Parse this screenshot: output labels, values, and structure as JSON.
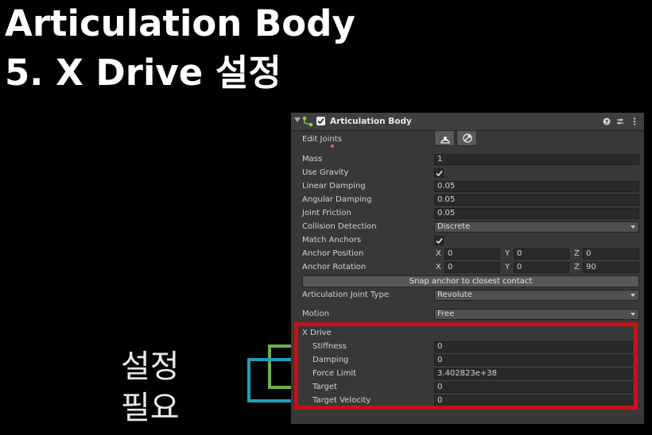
{
  "title": {
    "line1": "Articulation Body",
    "line2": "5. X Drive 설정"
  },
  "note": {
    "line1": "설정",
    "line2": "필요"
  },
  "panel": {
    "header": {
      "title": "Articulation Body",
      "enabled": true
    },
    "edit_joints_label": "Edit Joints",
    "mass": {
      "label": "Mass",
      "value": "1"
    },
    "use_gravity": {
      "label": "Use Gravity",
      "checked": true
    },
    "linear_damping": {
      "label": "Linear Damping",
      "value": "0.05"
    },
    "angular_damping": {
      "label": "Angular Damping",
      "value": "0.05"
    },
    "joint_friction": {
      "label": "Joint Friction",
      "value": "0.05"
    },
    "collision_detection": {
      "label": "Collision Detection",
      "value": "Discrete"
    },
    "match_anchors": {
      "label": "Match Anchors",
      "checked": true
    },
    "anchor_position": {
      "label": "Anchor Position",
      "x": "0",
      "y": "0",
      "z": "0"
    },
    "anchor_rotation": {
      "label": "Anchor Rotation",
      "x": "0",
      "y": "0",
      "z": "90"
    },
    "axis_labels": {
      "x": "X",
      "y": "Y",
      "z": "Z"
    },
    "snap_button": "Snap anchor to closest contact",
    "joint_type": {
      "label": "Articulation Joint Type",
      "value": "Revolute"
    },
    "motion": {
      "label": "Motion",
      "value": "Free"
    },
    "x_drive": {
      "label": "X Drive",
      "stiffness": {
        "label": "Stiffness",
        "value": "0"
      },
      "damping": {
        "label": "Damping",
        "value": "0"
      },
      "force_limit": {
        "label": "Force Limit",
        "value": "3.402823e+38"
      },
      "target": {
        "label": "Target",
        "value": "0"
      },
      "target_velocity": {
        "label": "Target Velocity",
        "value": "0"
      }
    }
  },
  "colors": {
    "highlight_box": "#c4121a",
    "bracket_green": "#6ab04c",
    "bracket_cyan": "#1f9fb5",
    "panel_bg": "#383838"
  }
}
